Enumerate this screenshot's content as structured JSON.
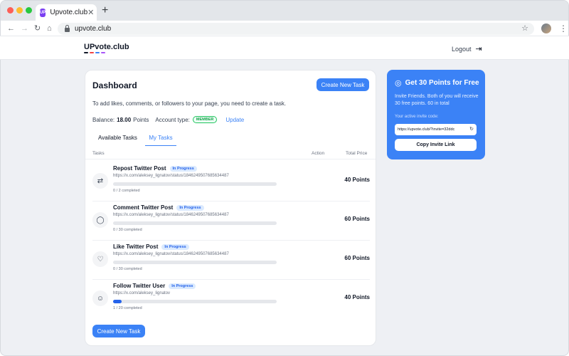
{
  "browser": {
    "tab_title": "Upvote.club",
    "tab_favicon": "UP",
    "url": "upvote.club"
  },
  "header": {
    "logo": "UPvote.club",
    "logo_bar_colors": [
      "#111827",
      "#ef4444",
      "#3b82f6",
      "#a855f7"
    ],
    "logout_label": "Logout"
  },
  "dashboard": {
    "title": "Dashboard",
    "create_task_label": "Create New Task",
    "intro": "To add likes, comments, or followers to your page, you need to create a task.",
    "balance_label": "Balance:",
    "balance_value": "18.00",
    "balance_unit": "Points",
    "account_type_label": "Account type:",
    "account_type_badge": "MEMBER",
    "upgrade_label": "Update",
    "tabs": [
      "Available Tasks",
      "My Tasks"
    ],
    "active_tab": "My Tasks",
    "columns": {
      "tasks": "Tasks",
      "action": "Action",
      "total_price": "Total Price"
    },
    "tasks": [
      {
        "name": "Repost Twitter Post",
        "status": "In Progress",
        "url": "https://x.com/aleksey_lignatov/status/1846249507685634487",
        "completed": 0,
        "total": 2,
        "progress_text": "0 / 2 completed",
        "price": "40 Points",
        "icon": "repost-icon"
      },
      {
        "name": "Comment Twitter Post",
        "status": "In Progress",
        "url": "https://x.com/aleksey_lignatov/status/1846249507685634487",
        "completed": 0,
        "total": 30,
        "progress_text": "0 / 30 completed",
        "price": "60 Points",
        "icon": "comment-icon"
      },
      {
        "name": "Like Twitter Post",
        "status": "In Progress",
        "url": "https://x.com/aleksey_lignatov/status/1846249507685634487",
        "completed": 0,
        "total": 30,
        "progress_text": "0 / 30 completed",
        "price": "60 Points",
        "icon": "heart-icon"
      },
      {
        "name": "Follow Twitter User",
        "status": "In Progress",
        "url": "https://x.com/aleksey_lignatov",
        "completed": 1,
        "total": 20,
        "progress_text": "1 / 20 completed",
        "price": "40 Points",
        "icon": "add-user-icon"
      }
    ]
  },
  "promo": {
    "title": "Get 30 Points for Free",
    "body": "Invite Friends. Both of you will receive 30 free points. 60 in total",
    "code_label": "Your active invite code:",
    "invite_link": "https://upvote.club/?invite=32ddc",
    "copy_label": "Copy Invite Link"
  },
  "colors": {
    "accent": "#3b82f6",
    "member_green": "#22c55e"
  }
}
